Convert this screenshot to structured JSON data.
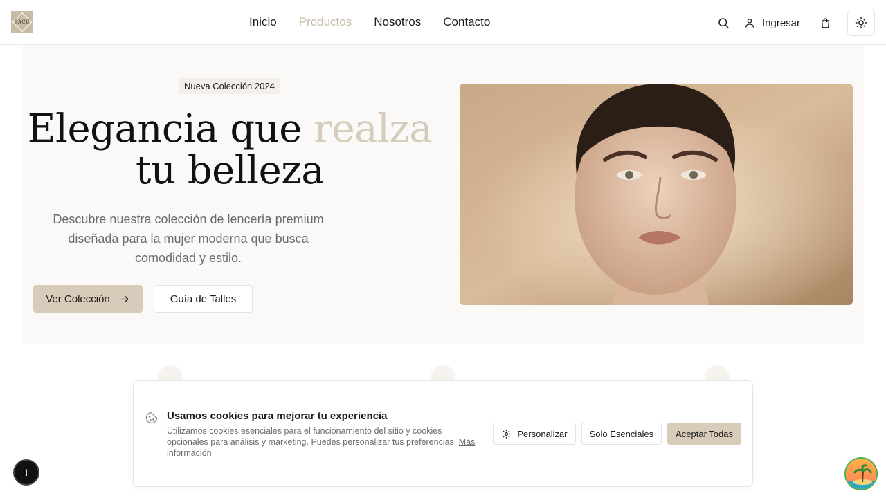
{
  "brand": {
    "logo_text": "SACÚ",
    "logo_color": "#c9bba6"
  },
  "nav": {
    "items": [
      {
        "label": "Inicio",
        "active": false
      },
      {
        "label": "Productos",
        "active": true
      },
      {
        "label": "Nosotros",
        "active": false
      },
      {
        "label": "Contacto",
        "active": false
      }
    ]
  },
  "header": {
    "search_icon": "search-icon",
    "login_label": "Ingresar",
    "cart_icon": "shopping-bag-icon",
    "theme_icon": "sun-icon"
  },
  "hero": {
    "badge": "Nueva Colección 2024",
    "title_part1": "Elegancia que ",
    "title_accent": "realza",
    "title_part2": "tu belleza",
    "description": "Descubre nuestra colección de lencería premium diseñada para la mujer moderna que busca comodidad y estilo.",
    "primary_cta": "Ver Colección",
    "secondary_cta": "Guía de Talles",
    "accent_color": "#d7ccbb"
  },
  "cookie_banner": {
    "title": "Usamos cookies para mejorar tu experiencia",
    "text": "Utilizamos cookies esenciales para el funcionamiento del sitio y cookies opcionales para análisis y marketing. Puedes personalizar tus preferencias.",
    "more_link": "Más información",
    "customize_label": "Personalizar",
    "essentials_label": "Solo Esenciales",
    "accept_label": "Aceptar Todas",
    "accept_color": "#d8cbb9"
  },
  "floating": {
    "notification_label": "!"
  }
}
